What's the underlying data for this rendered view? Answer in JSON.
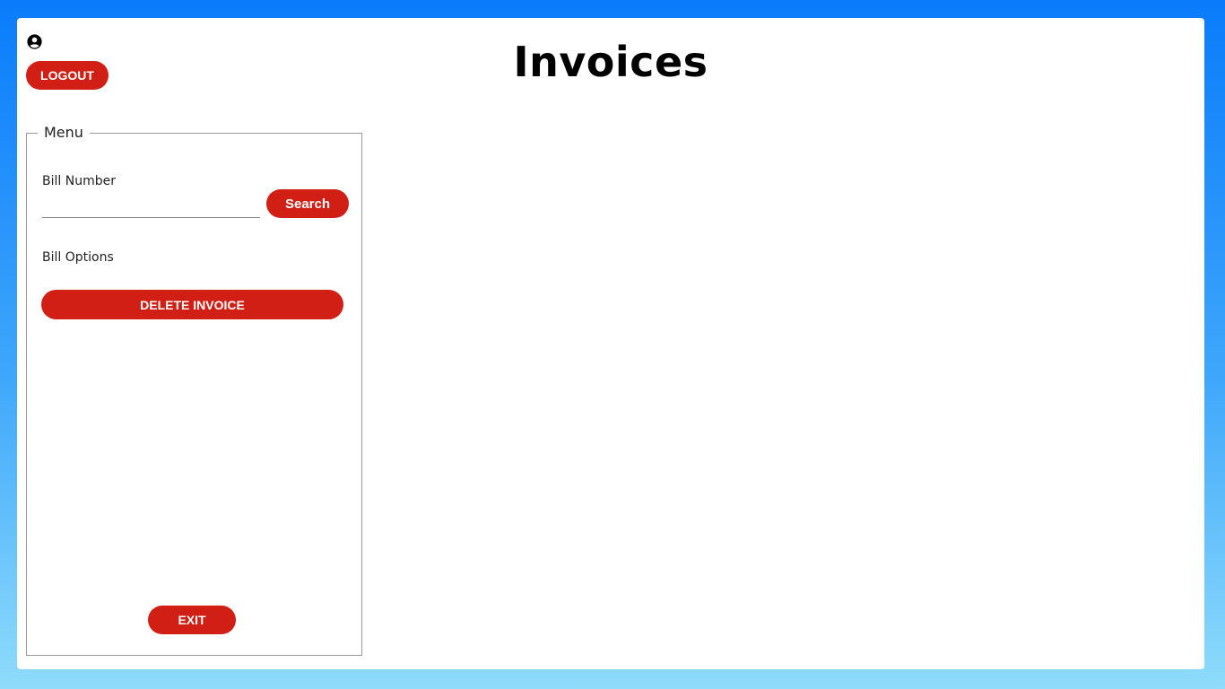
{
  "header": {
    "title": "Invoices",
    "user_icon": "user-circle-icon",
    "logout_label": "LOGOUT"
  },
  "menu": {
    "legend": "Menu",
    "bill_number_label": "Bill Number",
    "bill_number_value": "",
    "search_label": "Search",
    "bill_options_label": "Bill Options",
    "delete_invoice_label": "DELETE INVOICE",
    "exit_label": "EXIT"
  },
  "colors": {
    "accent": "#d11f16",
    "background_top": "#0a7cfb",
    "background_bottom": "#8fdcfb",
    "panel": "#ffffff"
  }
}
